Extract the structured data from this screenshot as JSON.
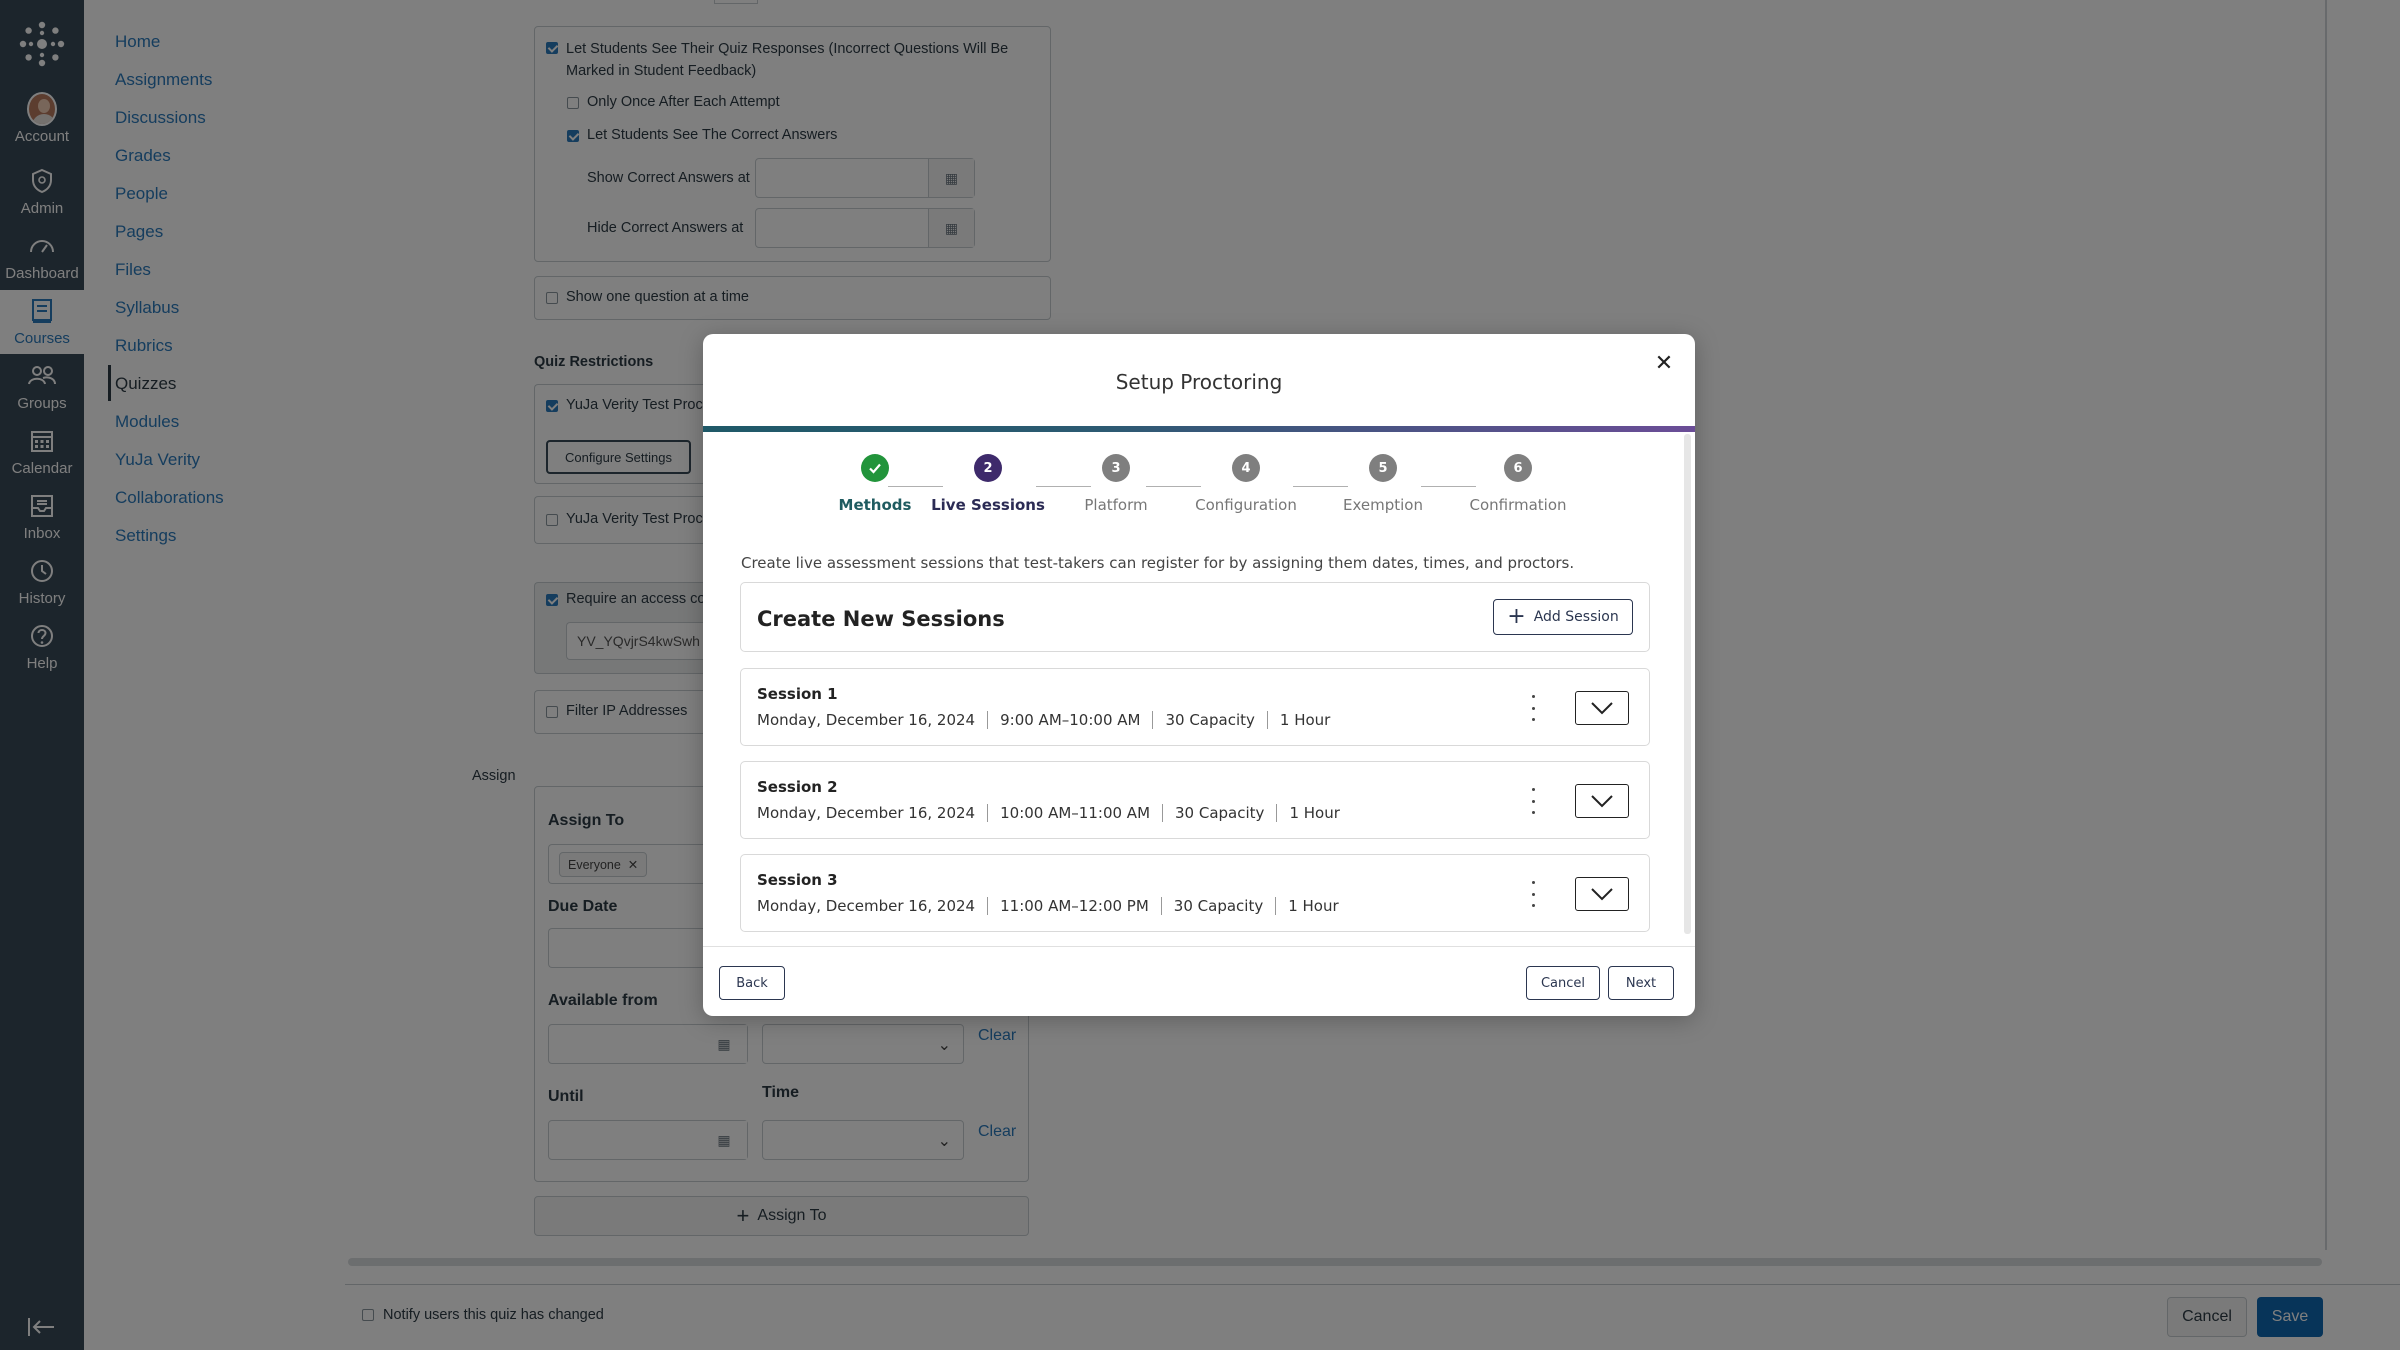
{
  "global_nav": {
    "items": [
      {
        "label": "Account",
        "icon": "avatar"
      },
      {
        "label": "Admin",
        "icon": "shield-icon"
      },
      {
        "label": "Dashboard",
        "icon": "dashboard-icon"
      },
      {
        "label": "Courses",
        "icon": "courses-icon",
        "active": true
      },
      {
        "label": "Groups",
        "icon": "groups-icon"
      },
      {
        "label": "Calendar",
        "icon": "calendar-icon"
      },
      {
        "label": "Inbox",
        "icon": "inbox-icon"
      },
      {
        "label": "History",
        "icon": "history-icon"
      },
      {
        "label": "Help",
        "icon": "help-icon"
      }
    ]
  },
  "course_nav": {
    "items": [
      "Home",
      "Assignments",
      "Discussions",
      "Grades",
      "People",
      "Pages",
      "Files",
      "Syllabus",
      "Rubrics",
      "Quizzes",
      "Modules",
      "YuJa Verity",
      "Collaborations",
      "Settings"
    ],
    "active": "Quizzes"
  },
  "background": {
    "responses_label": "Let Students See Their Quiz Responses (Incorrect Questions Will Be Marked in Student Feedback)",
    "only_once_label": "Only Once After Each Attempt",
    "correct_answers_label": "Let Students See The Correct Answers",
    "show_correct_label": "Show Correct Answers at",
    "hide_correct_label": "Hide Correct Answers at",
    "one_question_label": "Show one question at a time",
    "restrictions_heading": "Quiz Restrictions",
    "yuja_test_label": "YuJa Verity Test Proct",
    "configure_button": "Configure Settings",
    "yuja_test_label2": "YuJa Verity Test Proct",
    "access_code_label": "Require an access cod",
    "access_code_value": "YV_YQvjrS4kwSwh",
    "filter_ip_label": "Filter IP Addresses",
    "assign_label": "Assign",
    "assign_to_label": "Assign To",
    "everyone_tag": "Everyone",
    "due_date_label": "Due Date",
    "available_from_label": "Available from",
    "until_label": "Until",
    "time_label": "Time",
    "clear_1": "Clear",
    "clear_2": "Clear",
    "assign_to_button": "Assign To",
    "notify_label": "Notify users this quiz has changed",
    "cancel_button": "Cancel",
    "save_button": "Save"
  },
  "modal": {
    "title": "Setup Proctoring",
    "steps": [
      {
        "num": "",
        "label": "Methods",
        "state": "done"
      },
      {
        "num": "2",
        "label": "Live Sessions",
        "state": "current"
      },
      {
        "num": "3",
        "label": "Platform",
        "state": "todo"
      },
      {
        "num": "4",
        "label": "Configuration",
        "state": "todo"
      },
      {
        "num": "5",
        "label": "Exemption",
        "state": "todo"
      },
      {
        "num": "6",
        "label": "Confirmation",
        "state": "todo"
      }
    ],
    "description": "Create live assessment sessions that test-takers can register for by assigning them dates, times, and proctors.",
    "create_heading": "Create New Sessions",
    "add_session_label": "Add Session",
    "sessions": [
      {
        "title": "Session 1",
        "date": "Monday, December 16, 2024",
        "time": "9:00 AM–10:00 AM",
        "capacity": "30 Capacity",
        "duration": "1 Hour"
      },
      {
        "title": "Session 2",
        "date": "Monday, December 16, 2024",
        "time": "10:00 AM–11:00 AM",
        "capacity": "30 Capacity",
        "duration": "1 Hour"
      },
      {
        "title": "Session 3",
        "date": "Monday, December 16, 2024",
        "time": "11:00 AM–12:00 PM",
        "capacity": "30 Capacity",
        "duration": "1 Hour"
      }
    ],
    "back_label": "Back",
    "cancel_label": "Cancel",
    "next_label": "Next"
  },
  "colors": {
    "global_nav_bg": "#394b58",
    "link": "#2b7abc",
    "step_done": "#22943b",
    "step_current": "#3e2a6b",
    "save_button": "#0e68b3"
  }
}
